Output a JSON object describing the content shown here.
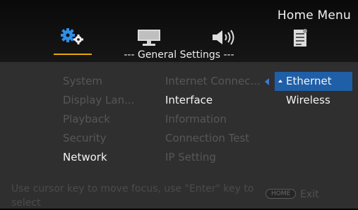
{
  "header": {
    "title": "Home Menu",
    "tabs": [
      {
        "icon": "gears-icon",
        "selected": true
      },
      {
        "icon": "monitor-icon",
        "selected": false
      },
      {
        "icon": "speaker-icon",
        "selected": false
      },
      {
        "icon": "document-icon",
        "selected": false
      }
    ]
  },
  "section_title": "--- General Settings ---",
  "menu": {
    "categories": [
      "System",
      "Display Lan...",
      "Playback",
      "Security",
      "Network"
    ],
    "active_category": "Network",
    "subitems": [
      "Internet Connec...",
      "Interface",
      "Information",
      "Connection Test",
      "IP Setting"
    ],
    "active_subitem": "Interface",
    "options": [
      "Ethernet",
      "Wireless"
    ],
    "selected_option": "Ethernet"
  },
  "footer": {
    "help_text": "Use cursor key to move focus, use \"Enter\" key to select",
    "home_button": "HOME",
    "exit_label": "Exit"
  },
  "colors": {
    "accent": "#e6a800",
    "highlight": "#1f5fa8"
  }
}
